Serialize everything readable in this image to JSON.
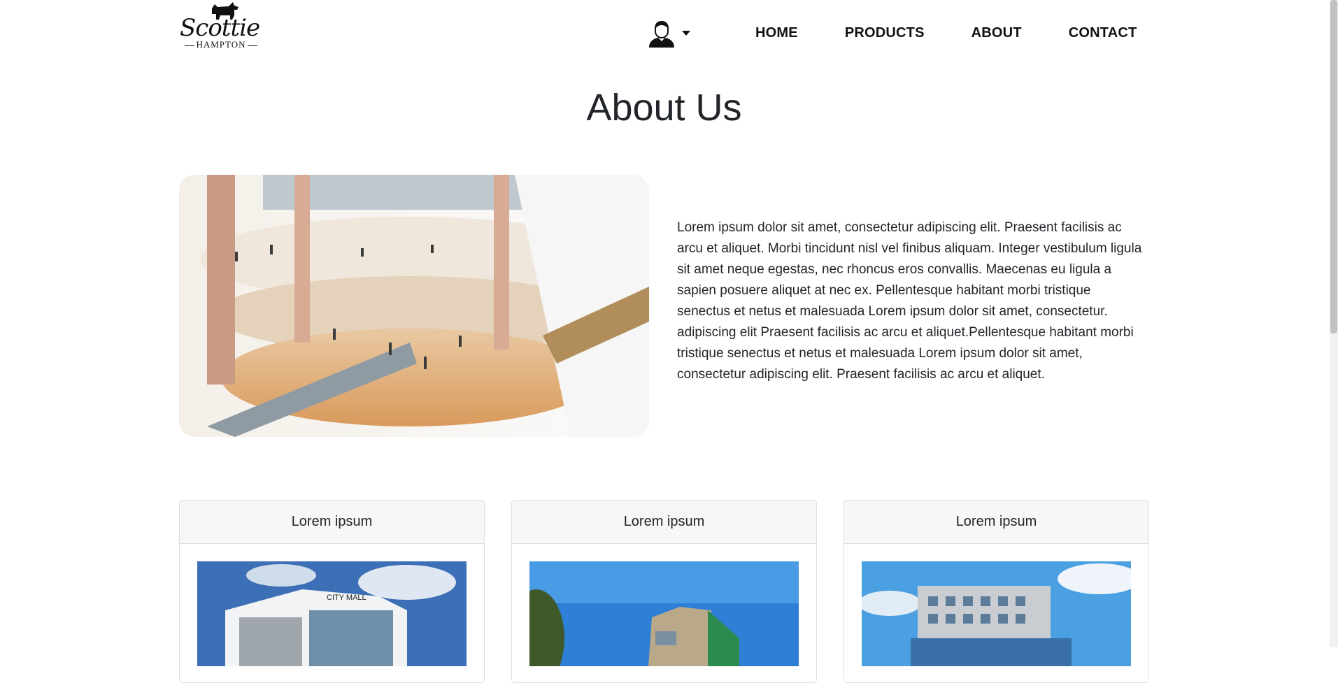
{
  "header": {
    "logo_text": "Scottie",
    "logo_subtext": "HAMPTON",
    "user_icon": "user-avatar-icon",
    "nav": {
      "home": "HOME",
      "products": "PRODUCTS",
      "about": "ABOUT",
      "contact": "CONTACT"
    }
  },
  "main": {
    "title": "About Us",
    "about_text": "Lorem ipsum dolor sit amet, consectetur adipiscing elit. Praesent facilisis ac arcu et aliquet. Morbi tincidunt nisl vel finibus aliquam. Integer vestibulum ligula sit amet neque egestas, nec rhoncus eros convallis. Maecenas eu ligula a sapien posuere aliquet at nec ex. Pellentesque habitant morbi tristique senectus et netus et malesuada Lorem ipsum dolor sit amet, consectetur. adipiscing elit Praesent facilisis ac arcu et aliquet.Pellentesque habitant morbi tristique senectus et netus et malesuada Lorem ipsum dolor sit amet, consectetur adipiscing elit. Praesent facilisis ac arcu et aliquet.",
    "cards": [
      {
        "title": "Lorem ipsum"
      },
      {
        "title": "Lorem ipsum"
      },
      {
        "title": "Lorem ipsum"
      }
    ]
  },
  "colors": {
    "text": "#212529",
    "nav_text": "#111111",
    "card_header_bg": "#f7f7f7",
    "card_border": "#dfdfdf"
  }
}
